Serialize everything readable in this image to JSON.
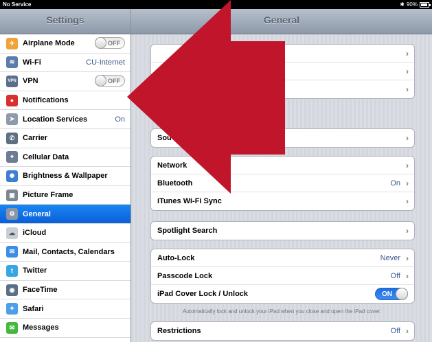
{
  "status_bar": {
    "carrier": "No Service",
    "battery": "90%"
  },
  "sidebar": {
    "title": "Settings",
    "items": [
      {
        "label": "Airplane Mode",
        "icon": "airplane-icon",
        "color": "#f2a23a",
        "glyph": "✈",
        "toggle": "OFF"
      },
      {
        "label": "Wi-Fi",
        "icon": "wifi-icon",
        "color": "#5a7ea8",
        "glyph": "≋",
        "value": "CU-Internet"
      },
      {
        "label": "VPN",
        "icon": "vpn-icon",
        "color": "#5b6f8c",
        "glyph": "VPN",
        "toggle": "OFF"
      },
      {
        "label": "Notifications",
        "icon": "notifications-icon",
        "color": "#d8302f",
        "glyph": "●"
      },
      {
        "label": "Location Services",
        "icon": "location-icon",
        "color": "#8f9aab",
        "glyph": "➤",
        "value": "On"
      },
      {
        "label": "Carrier",
        "icon": "phone-icon",
        "color": "#5f6f80",
        "glyph": "✆"
      },
      {
        "label": "Cellular Data",
        "icon": "cellular-icon",
        "color": "#6d7c96",
        "glyph": "⌖"
      },
      {
        "label": "Brightness & Wallpaper",
        "icon": "brightness-icon",
        "color": "#3f7fd2",
        "glyph": "✺"
      },
      {
        "label": "Picture Frame",
        "icon": "picture-frame-icon",
        "color": "#7b8793",
        "glyph": "▣"
      },
      {
        "label": "General",
        "icon": "gear-icon",
        "color": "#8a96a5",
        "glyph": "⚙",
        "selected": true
      },
      {
        "label": "iCloud",
        "icon": "cloud-icon",
        "color": "#c9cfd8",
        "glyph": "☁"
      },
      {
        "label": "Mail, Contacts, Calendars",
        "icon": "mail-icon",
        "color": "#3a8ee6",
        "glyph": "✉"
      },
      {
        "label": "Twitter",
        "icon": "twitter-icon",
        "color": "#36a7e3",
        "glyph": "t"
      },
      {
        "label": "FaceTime",
        "icon": "facetime-icon",
        "color": "#5d6f86",
        "glyph": "◉"
      },
      {
        "label": "Safari",
        "icon": "safari-icon",
        "color": "#4da0e8",
        "glyph": "✦"
      },
      {
        "label": "Messages",
        "icon": "messages-icon",
        "color": "#45b83f",
        "glyph": "✉"
      }
    ]
  },
  "main": {
    "title": "General",
    "group1": [
      {
        "label": ""
      },
      {
        "label": ""
      },
      {
        "label": ""
      }
    ],
    "group2": [
      {
        "label": "Sou"
      }
    ],
    "group3": [
      {
        "label": "Network"
      },
      {
        "label": "Bluetooth",
        "value": "On"
      },
      {
        "label": "iTunes Wi-Fi Sync"
      }
    ],
    "group4": [
      {
        "label": "Spotlight Search"
      }
    ],
    "group5": [
      {
        "label": "Auto-Lock",
        "value": "Never"
      },
      {
        "label": "Passcode Lock",
        "value": "Off"
      },
      {
        "label": "iPad Cover Lock / Unlock",
        "toggle": "ON"
      }
    ],
    "footnote": "Automatically lock and unlock your iPad when you close and open the iPad cover.",
    "group6": [
      {
        "label": "Restrictions",
        "value": "Off"
      }
    ],
    "chevron": "›"
  },
  "overlay": {
    "arrow_color": "#c0152a"
  }
}
